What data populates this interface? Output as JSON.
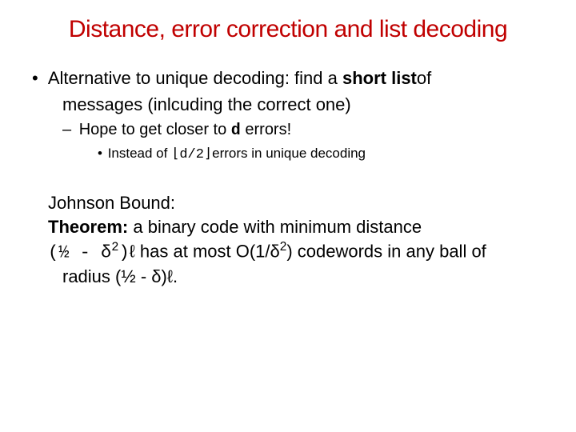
{
  "title": "Distance, error correction and list decoding",
  "b1_a": "Alternative to unique decoding: find a ",
  "b1_b": "short list",
  "b1_c": "of",
  "b1_cont": "messages (inlcuding the correct one)",
  "b2_a": "Hope to get closer to ",
  "b2_b": "d",
  "b2_c": " errors!",
  "b3_a": "Instead of ",
  "b3_b": "⌊d/2⌋",
  "b3_c": "errors in unique decoding",
  "jb_label": "Johnson Bound:",
  "thm_a": "Theorem:",
  "thm_b": " a binary code with minimum distance",
  "thm2_a": "(½ - δ",
  "thm2_sup": "2",
  "thm2_b": ")",
  "thm2_c": "ℓ has at most O(1/δ",
  "thm2_sup2": "2",
  "thm2_d": ") codewords in any ball of",
  "thm3": "radius (½ - δ)ℓ."
}
